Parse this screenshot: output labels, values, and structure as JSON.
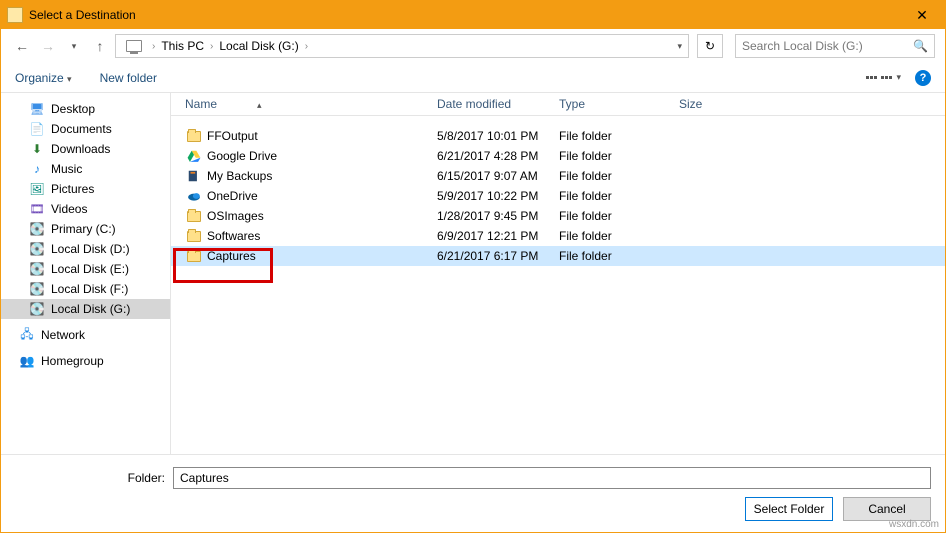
{
  "window": {
    "title": "Select a Destination"
  },
  "breadcrumb": {
    "root": "This PC",
    "loc": "Local Disk (G:)"
  },
  "search": {
    "placeholder": "Search Local Disk (G:)"
  },
  "toolbar": {
    "organize": "Organize",
    "newfolder": "New folder"
  },
  "columns": {
    "name": "Name",
    "date": "Date modified",
    "type": "Type",
    "size": "Size"
  },
  "tree": {
    "desktop": "Desktop",
    "documents": "Documents",
    "downloads": "Downloads",
    "music": "Music",
    "pictures": "Pictures",
    "videos": "Videos",
    "primary": "Primary (C:)",
    "ldd": "Local Disk (D:)",
    "lde": "Local Disk (E:)",
    "ldf": "Local Disk (F:)",
    "ldg": "Local Disk (G:)",
    "network": "Network",
    "homegroup": "Homegroup"
  },
  "rows": {
    "r0": {
      "name": "FFOutput",
      "date": "5/8/2017 10:01 PM",
      "type": "File folder"
    },
    "r1": {
      "name": "Google Drive",
      "date": "6/21/2017 4:28 PM",
      "type": "File folder"
    },
    "r2": {
      "name": "My Backups",
      "date": "6/15/2017 9:07 AM",
      "type": "File folder"
    },
    "r3": {
      "name": "OneDrive",
      "date": "5/9/2017 10:22 PM",
      "type": "File folder"
    },
    "r4": {
      "name": "OSImages",
      "date": "1/28/2017 9:45 PM",
      "type": "File folder"
    },
    "r5": {
      "name": "Softwares",
      "date": "6/9/2017 12:21 PM",
      "type": "File folder"
    },
    "r6": {
      "name": "Captures",
      "date": "6/21/2017 6:17 PM",
      "type": "File folder"
    }
  },
  "footer": {
    "label": "Folder:",
    "value": "Captures",
    "select": "Select Folder",
    "cancel": "Cancel"
  },
  "watermark": "wsxdn.com"
}
